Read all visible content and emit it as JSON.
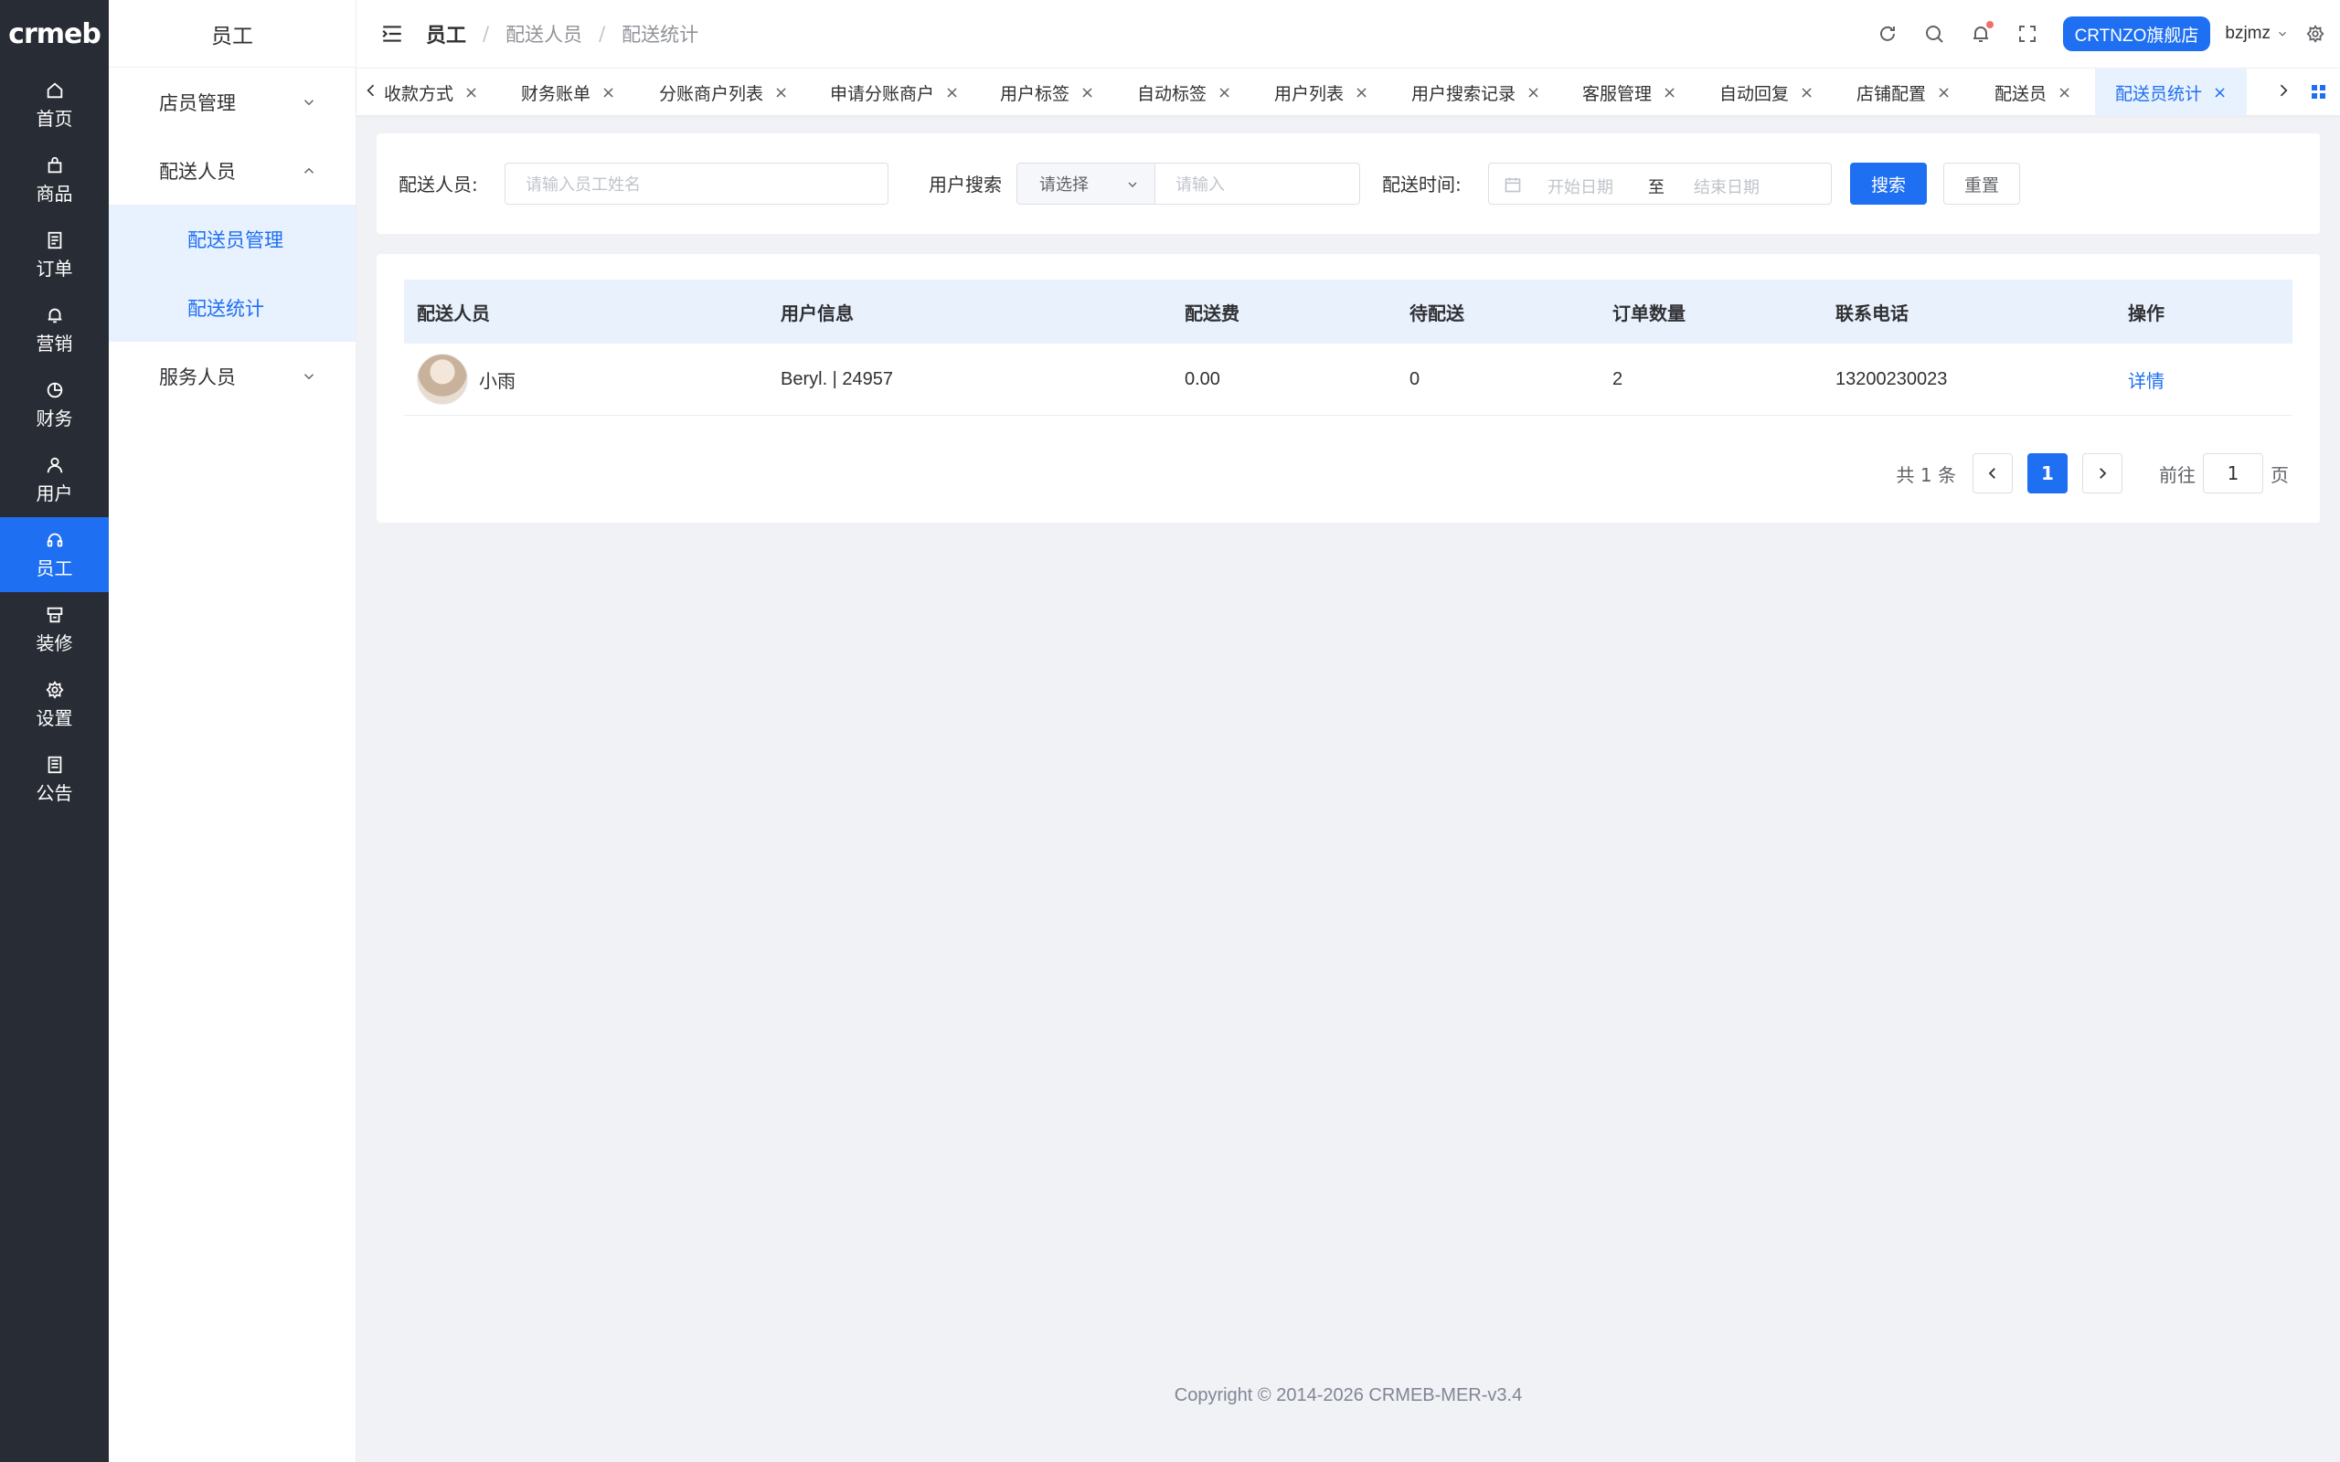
{
  "app": {
    "logo": "crmeb"
  },
  "rail": {
    "items": [
      {
        "label": "首页",
        "icon": "home-icon"
      },
      {
        "label": "商品",
        "icon": "bag-icon"
      },
      {
        "label": "订单",
        "icon": "order-icon"
      },
      {
        "label": "营销",
        "icon": "bell-icon"
      },
      {
        "label": "财务",
        "icon": "pie-icon"
      },
      {
        "label": "用户",
        "icon": "user-icon"
      },
      {
        "label": "员工",
        "icon": "headset-icon"
      },
      {
        "label": "装修",
        "icon": "decor-icon"
      },
      {
        "label": "设置",
        "icon": "gear-icon"
      },
      {
        "label": "公告",
        "icon": "notice-icon"
      }
    ],
    "active_index": 6
  },
  "subnav": {
    "title": "员工",
    "groups": [
      {
        "label": "店员管理",
        "expanded": false
      },
      {
        "label": "配送人员",
        "expanded": true,
        "children": [
          "配送员管理",
          "配送统计"
        ]
      },
      {
        "label": "服务人员",
        "expanded": false
      }
    ]
  },
  "header": {
    "breadcrumb": [
      "员工",
      "配送人员",
      "配送统计"
    ],
    "store_button": "CRTNZO旗舰店",
    "username": "bzjmz"
  },
  "tabs": {
    "items": [
      "收款方式",
      "财务账单",
      "分账商户列表",
      "申请分账商户",
      "用户标签",
      "自动标签",
      "用户列表",
      "用户搜索记录",
      "客服管理",
      "自动回复",
      "店铺配置",
      "配送员",
      "配送员统计"
    ],
    "active_index": 12,
    "close_glyph": "×"
  },
  "filter": {
    "courier_label": "配送人员:",
    "courier_placeholder": "请输入员工姓名",
    "user_search_label": "用户搜索",
    "user_select_value": "请选择",
    "user_input_placeholder": "请输入",
    "time_label": "配送时间:",
    "start_placeholder": "开始日期",
    "range_sep": "至",
    "end_placeholder": "结束日期",
    "search_button": "搜索",
    "reset_button": "重置"
  },
  "table": {
    "columns": [
      "配送人员",
      "用户信息",
      "配送费",
      "待配送",
      "订单数量",
      "联系电话",
      "操作"
    ],
    "rows": [
      {
        "name": "小雨",
        "user_info": "Beryl. | 24957",
        "fee": "0.00",
        "pending": "0",
        "orders": "2",
        "phone": "13200230023",
        "action": "详情"
      }
    ]
  },
  "pagination": {
    "total_text": "共 1 条",
    "current_page": "1",
    "goto_label": "前往",
    "goto_value": "1",
    "page_suffix": "页"
  },
  "footer": {
    "copyright": "Copyright © 2014-2026 CRMEB-MER-v3.4"
  },
  "colors": {
    "primary": "#1e6ff1",
    "rail_bg": "#282c34",
    "page_bg": "#f0f2f5",
    "header_row_bg": "#e9f1fd"
  }
}
